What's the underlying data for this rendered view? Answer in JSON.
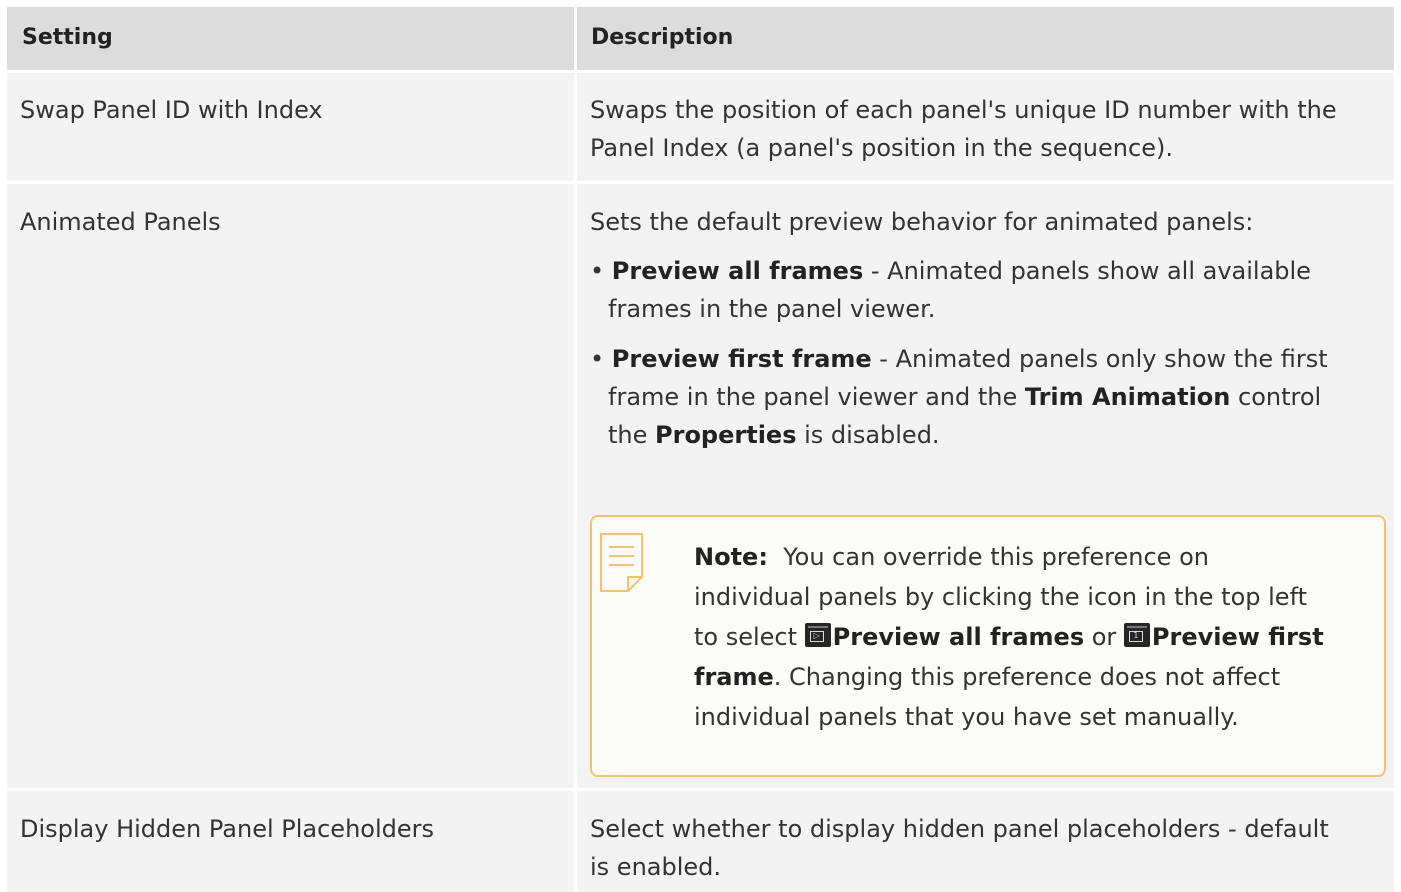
{
  "headers": {
    "setting": "Setting",
    "description": "Description"
  },
  "rows": [
    {
      "setting": "Swap Panel ID with Index",
      "description_lines": [
        "Swaps the position of each panel's unique ID number with the",
        "Panel Index (a panel's position in the sequence)."
      ]
    },
    {
      "setting": "Animated Panels",
      "intro": "Sets the default preview behavior for animated panels:",
      "bullets": [
        {
          "bold": "Preview all frames",
          "text1": " - Animated panels show all available",
          "text2": "frames in the panel viewer."
        },
        {
          "bold": "Preview first frame",
          "text1": " - Animated panels only show the first",
          "text2a": "frame in the panel viewer and the ",
          "bold2": "Trim Animation",
          "text2b": " control",
          "text3a": "the ",
          "bold3": "Properties",
          "text3b": " is disabled."
        }
      ],
      "note": {
        "label": "Note:",
        "line1": "You can override this preference on",
        "line2": "individual panels by clicking the icon in the top left",
        "line3a": "to select ",
        "opt1": "Preview all frames",
        "or": " or ",
        "opt2a": "Preview first",
        "opt2b": "frame",
        "line4b": ". Changing this preference does not affect",
        "line5": "individual panels that you have set manually."
      }
    },
    {
      "setting": "Display Hidden Panel Placeholders",
      "description_lines": [
        "Select whether to display hidden panel placeholders - default",
        "is enabled."
      ]
    }
  ],
  "colors": {
    "header_bg": "#dcdcdc",
    "row_bg": "#f3f3f3",
    "note_border": "#f5c16c"
  },
  "icons": [
    "note-icon",
    "preview-all-frames-icon",
    "preview-first-frame-icon"
  ]
}
